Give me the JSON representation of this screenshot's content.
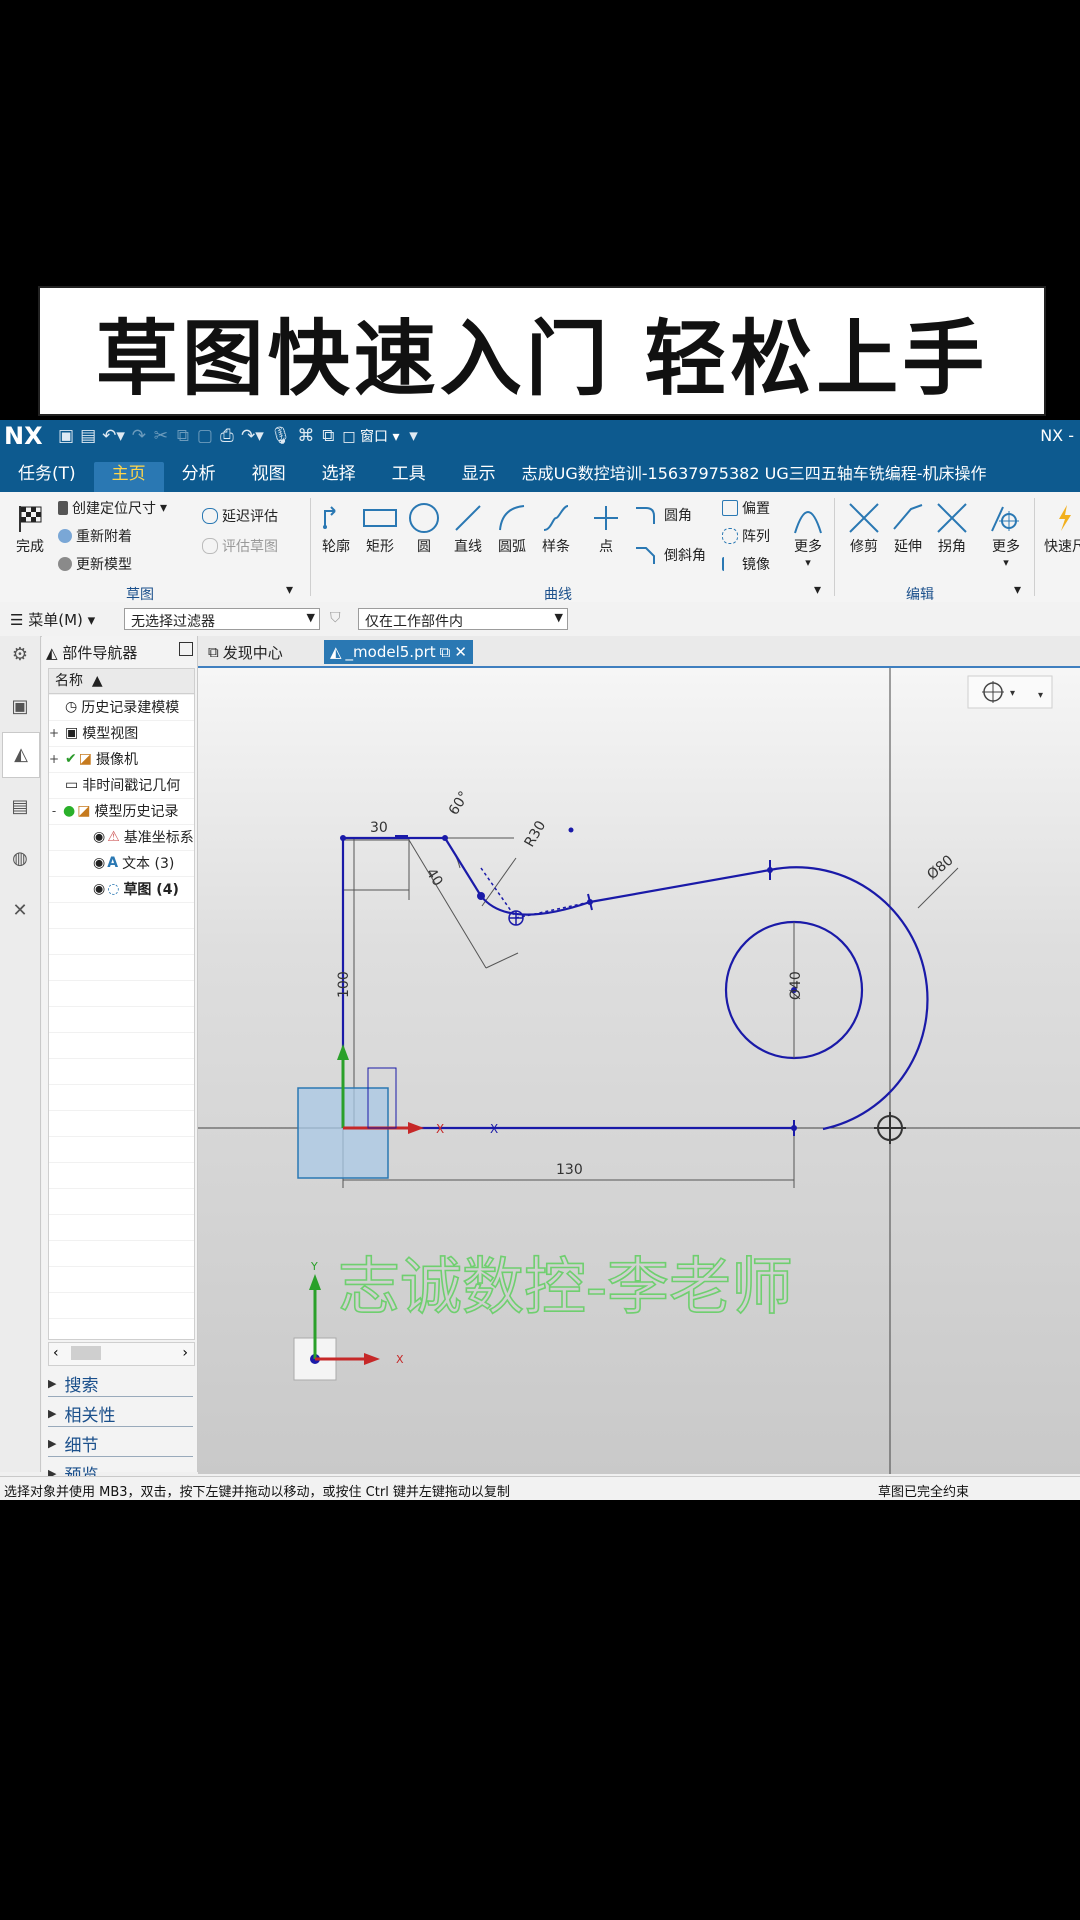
{
  "banner": {
    "title": "草图快速入门 轻松上手"
  },
  "titlebar": {
    "logo": "NX",
    "window_menu": "窗口",
    "right_label": "NX -"
  },
  "menubar": {
    "items": [
      "任务(T)",
      "主页",
      "分析",
      "视图",
      "选择",
      "工具",
      "显示"
    ],
    "active": "主页",
    "info": "志成UG数控培训-15637975382  UG三四五轴车铣编程-机床操作"
  },
  "ribbon": {
    "sketch_group": {
      "finish": "完成",
      "create_dim": "创建定位尺寸",
      "reattach": "重新附着",
      "update_model": "更新模型",
      "delay_eval": "延迟评估",
      "eval_sketch": "评估草图",
      "label": "草图"
    },
    "curve_group": {
      "tools": [
        "轮廓",
        "矩形",
        "圆",
        "直线",
        "圆弧",
        "样条",
        "点"
      ],
      "fillet": "圆角",
      "chamfer": "倒斜角",
      "offset": "偏置",
      "pattern": "阵列",
      "mirror": "镜像",
      "more": "更多",
      "label": "曲线"
    },
    "edit_group": {
      "tools": [
        "修剪",
        "延伸",
        "拐角",
        "更多"
      ],
      "label": "编辑"
    },
    "quick": "快速尺"
  },
  "filterbar": {
    "menu": "菜单(M)",
    "filter": "无选择过滤器",
    "scope": "仅在工作部件内"
  },
  "navigator": {
    "title": "部件导航器",
    "column": "名称",
    "rows": [
      {
        "exp": "",
        "label": "历史记录建模模"
      },
      {
        "exp": "+",
        "label": "模型视图"
      },
      {
        "exp": "+",
        "label": "摄像机"
      },
      {
        "exp": "",
        "label": "非时间戳记几何"
      },
      {
        "exp": "-",
        "label": "模型历史记录"
      },
      {
        "exp": "",
        "label": "基准坐标系"
      },
      {
        "exp": "",
        "label": "文本 (3)"
      },
      {
        "exp": "",
        "label": "草图 (4)"
      }
    ],
    "sections": [
      "搜索",
      "相关性",
      "细节",
      "预览"
    ]
  },
  "tabs": {
    "discovery": "发现中心",
    "model": "_model5.prt"
  },
  "viewport": {
    "dims": {
      "d30": "30",
      "d40": "40",
      "d60": "60°",
      "r30": "R30",
      "d100": "100",
      "d130": "130",
      "dia80": "Ø80",
      "dia40": "Ø40"
    },
    "watermark": "志诚数控-李老师",
    "axis_x": "X",
    "axis_y": "Y"
  },
  "status": {
    "left": "选择对象并使用 MB3，双击，按下左键并拖动以移动，或按住 Ctrl 键并左键拖动以复制",
    "right": "草图已完全约束"
  },
  "colors": {
    "title_blue": "#0d5a8f",
    "sketch_blue": "#1a1aa8",
    "active_tab": "#2a78b3",
    "accent_yellow": "#ffd54a",
    "watermark_green": "#6fcf6f"
  }
}
